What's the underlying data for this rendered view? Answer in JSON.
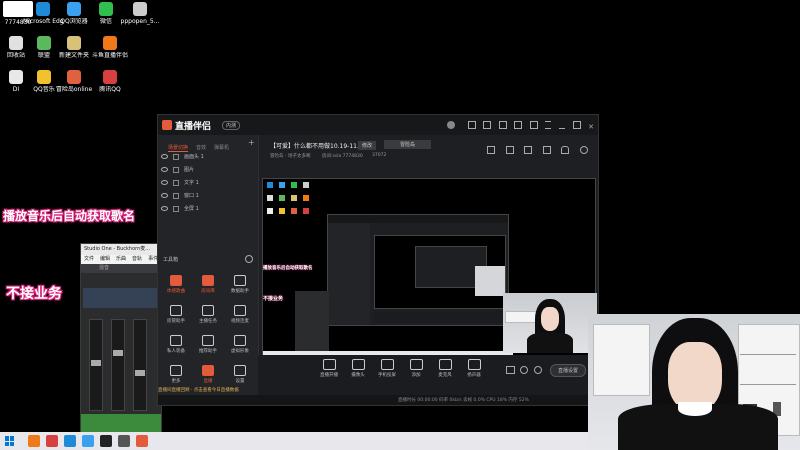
{
  "desktop": {
    "top_left_badge": "7774830",
    "icons": [
      {
        "label": "Microsoft Edge",
        "color": "#1f8ad8"
      },
      {
        "label": "QQ浏览器",
        "color": "#3aa0f0"
      },
      {
        "label": "微信",
        "color": "#2fbf4e"
      },
      {
        "label": "pppopen_5...",
        "color": "#cccccc"
      },
      {
        "label": "回收站",
        "color": "#e0e0e0"
      },
      {
        "label": "联盟",
        "color": "#5cb85c"
      },
      {
        "label": "新建文件夹",
        "color": "#d8c27a"
      },
      {
        "label": "斗鱼直播伴侣",
        "color": "#f07a1a"
      },
      {
        "label": "DI",
        "color": "#e8e8e8"
      },
      {
        "label": "QQ音乐",
        "color": "#f2c12e"
      },
      {
        "label": "冒险岛online",
        "color": "#e06040"
      },
      {
        "label": "腾讯QQ",
        "color": "#d84040"
      }
    ]
  },
  "overlays": {
    "auto_song": "播放音乐后自动获取歌名",
    "no_business": "不接业务"
  },
  "app": {
    "logo": "直播伴侣",
    "logo_badge": "内测",
    "stream_title": "【可爱】什么都不用做10.19-11.1",
    "edit_label": "修改",
    "category": "冒险岛",
    "sub_info": "冒险岛 - 场子太多啊",
    "room_id": "房间:ssla  7774830",
    "fans": "37072",
    "left_tabs": [
      "场景切换",
      "音效",
      "弹幕机"
    ],
    "layers": [
      "画面头 1",
      "图片",
      "文字 1",
      "窗口 1",
      "全屏 1"
    ],
    "toolbox_title": "工具箱",
    "tools": [
      {
        "label": "体感歌曲",
        "hot": true
      },
      {
        "label": "房间库",
        "hot": true
      },
      {
        "label": "数据助手",
        "hot": false
      },
      {
        "label": "房管助手",
        "hot": false
      },
      {
        "label": "主播任务",
        "hot": false
      },
      {
        "label": "视频连麦",
        "hot": false
      },
      {
        "label": "私人装备",
        "hot": false
      },
      {
        "label": "推荐助手",
        "hot": false
      },
      {
        "label": "虚拟形象",
        "hot": false
      },
      {
        "label": "更多",
        "hot": false
      },
      {
        "label": "直播",
        "hot": true
      },
      {
        "label": "设置",
        "hot": false
      }
    ],
    "bottom_tools": [
      "直播开播",
      "摄像头",
      "手机投屏",
      "添加",
      "麦克风",
      "扬声器"
    ],
    "go_live": "直播设置",
    "notice": "直播间直播回顾 · 点击查看今日直播数据",
    "status": "直播时长 00:00:00   码率 0kb/s   丢帧 0.0%   CPU 18%   内存 52%"
  },
  "studio": {
    "title": "Studio One - Buckhorn麦...",
    "menu": [
      "文件",
      "编辑",
      "乐曲",
      "音轨",
      "事件"
    ],
    "tab": "混音"
  },
  "colors": {
    "accent": "#e35b3a",
    "overlay_stroke": "#d8247a"
  }
}
